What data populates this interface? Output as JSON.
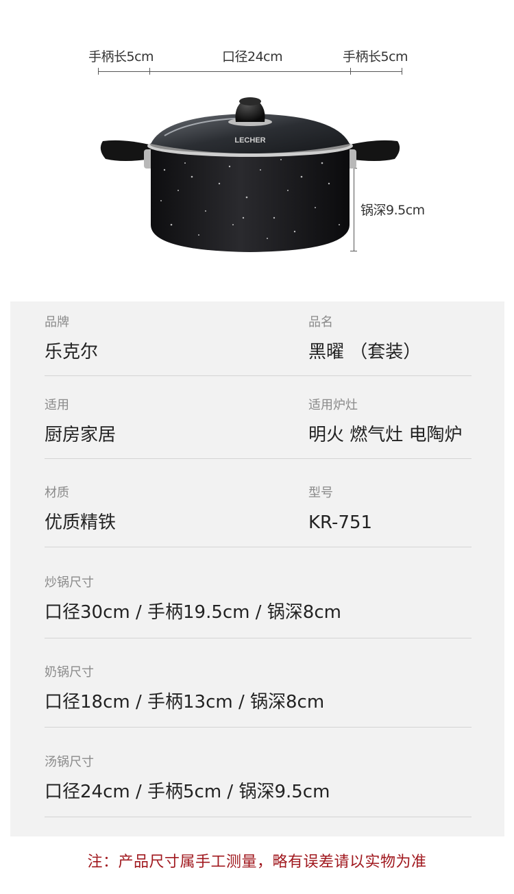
{
  "dimensions": {
    "handle_left": "手柄长5cm",
    "diameter": "口径24cm",
    "handle_right": "手柄长5cm",
    "depth": "锅深9.5cm",
    "lid_logo": "LECHER"
  },
  "specs": [
    {
      "left": {
        "label": "品牌",
        "value": "乐克尔"
      },
      "right": {
        "label": "品名",
        "value": "黑曜 （套装）"
      }
    },
    {
      "left": {
        "label": "适用",
        "value": "厨房家居"
      },
      "right": {
        "label": "适用炉灶",
        "value": "明火 燃气灶 电陶炉"
      }
    },
    {
      "left": {
        "label": "材质",
        "value": "优质精铁"
      },
      "right": {
        "label": "型号",
        "value": "KR-751"
      }
    }
  ],
  "sizes": [
    {
      "label": "炒锅尺寸",
      "value": "口径30cm / 手柄19.5cm / 锅深8cm"
    },
    {
      "label": "奶锅尺寸",
      "value": "口径18cm / 手柄13cm / 锅深8cm"
    },
    {
      "label": "汤锅尺寸",
      "value": "口径24cm / 手柄5cm / 锅深9.5cm"
    }
  ],
  "note": "注：产品尺寸属手工测量，略有误差请以实物为准",
  "colors": {
    "panel_bg": "#f2f2f2",
    "note": "#a0181e",
    "label": "#8a8a8a"
  }
}
